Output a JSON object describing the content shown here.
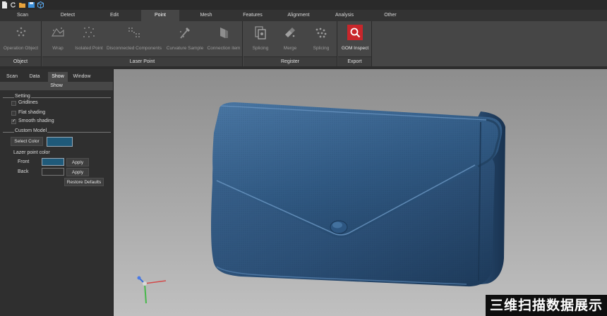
{
  "quick_access": {
    "icons": [
      "new-file-icon",
      "refresh-icon",
      "open-folder-icon",
      "save-icon",
      "cube-icon"
    ]
  },
  "menu": {
    "tabs": [
      "Scan",
      "Detect",
      "Edit",
      "Point",
      "Mesh",
      "Features",
      "Alignment",
      "Analysis",
      "Other"
    ],
    "active": "Point"
  },
  "ribbon": {
    "groups": [
      {
        "label": "Object",
        "buttons": [
          "Operation Object"
        ]
      },
      {
        "label": "Laser Point",
        "buttons": [
          "Wrap",
          "Isolated Point",
          "Disconnected Components",
          "Curvature Sample",
          "Connection item"
        ]
      },
      {
        "label": "Register",
        "buttons": [
          "Splicing",
          "Merge",
          "Splicing"
        ]
      },
      {
        "label": "Export",
        "buttons": [
          "GOM Inspect"
        ]
      }
    ]
  },
  "panel": {
    "tabs": [
      "Scan",
      "Data",
      "Show",
      "Window"
    ],
    "active_tab": "Show",
    "header": "Show",
    "setting_title": "Setting",
    "options": [
      {
        "label": "Gridlines",
        "checked": false
      },
      {
        "label": "Flat shading",
        "checked": false
      },
      {
        "label": "Smooth shading",
        "checked": true
      }
    ],
    "custom_model_title": "Custom Model",
    "select_color_label": "Select Color",
    "model_color": "#1f5a7a",
    "lazer_title": "Lazer point color",
    "front_label": "Front",
    "back_label": "Back",
    "front_color": "#1f5a7a",
    "back_color": "#2f2f2f",
    "apply_label": "Apply",
    "restore_label": "Restore Defaults"
  },
  "viewport": {
    "model_color": "#2c4f73",
    "watermark": "三维扫描数据展示"
  },
  "colors": {
    "accent_red": "#c8262b",
    "ribbon_bg": "#464646"
  }
}
